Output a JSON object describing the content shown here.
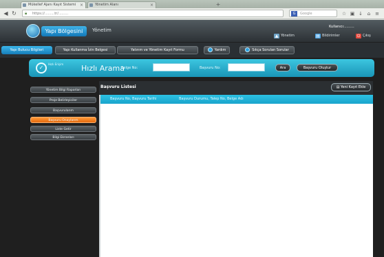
{
  "browser": {
    "tabs": [
      {
        "label": "Mükellef Ajanı Kayıt Sistemi"
      },
      {
        "label": "Yönetim Alanı"
      }
    ],
    "url": "https://.........tr/.........",
    "search_engine_glyph": "G",
    "search_placeholder": "Google"
  },
  "header": {
    "brand": "Yapı Bölgesini",
    "subsystem": "Yönetim",
    "user_info": "Kullanıcı:.........",
    "links": [
      {
        "label": "Yönetim",
        "icon": "person-icon",
        "color": "#6fa4c8"
      },
      {
        "label": "Bildirimler",
        "icon": "chart-icon",
        "color": "#4ba2e3"
      },
      {
        "label": "Çıkış",
        "icon": "exit-icon",
        "color": "#e2473c"
      }
    ]
  },
  "menu": {
    "items": [
      {
        "label": "Yapı Bulucu Bilgileri",
        "style": "blue"
      },
      {
        "label": "Yapı Kullanma İzin Belgesi",
        "style": "dark"
      },
      {
        "label": "Yatırım ve Yönetim Kayıt Formu",
        "style": "dark"
      },
      {
        "label": "Yardım",
        "style": "dark"
      },
      {
        "label": "Sıkça Sorulan Sorular",
        "style": "dark"
      }
    ]
  },
  "quick_search": {
    "small_label": "Hızlı Erişim",
    "title": "Hızlı Arama",
    "field1_label": "Belge No:",
    "field1_value": "",
    "field2_label": "Başvuru No:",
    "field2_value": "",
    "button1": "Ara",
    "button2": "Başvuru Oluştur"
  },
  "sidebar": {
    "items": [
      {
        "label": "Yönetim Bilgi Raporları",
        "active": false
      },
      {
        "label": "Proje Belirleyiciler",
        "active": false
      },
      {
        "label": "Başvurularım",
        "active": false
      },
      {
        "label": "Başvuru Onaylarım",
        "active": true
      },
      {
        "label": "Liste Getir",
        "active": false
      },
      {
        "label": "Bilgi Ekranları",
        "active": false
      }
    ]
  },
  "content": {
    "title": "Başvuru Listesi",
    "new_button": "Yeni Kayıt Ekle",
    "columns": [
      "Başvuru No, Başvuru Tarihi",
      "Başvuru Durumu, Talep No, Belge Adı"
    ]
  }
}
